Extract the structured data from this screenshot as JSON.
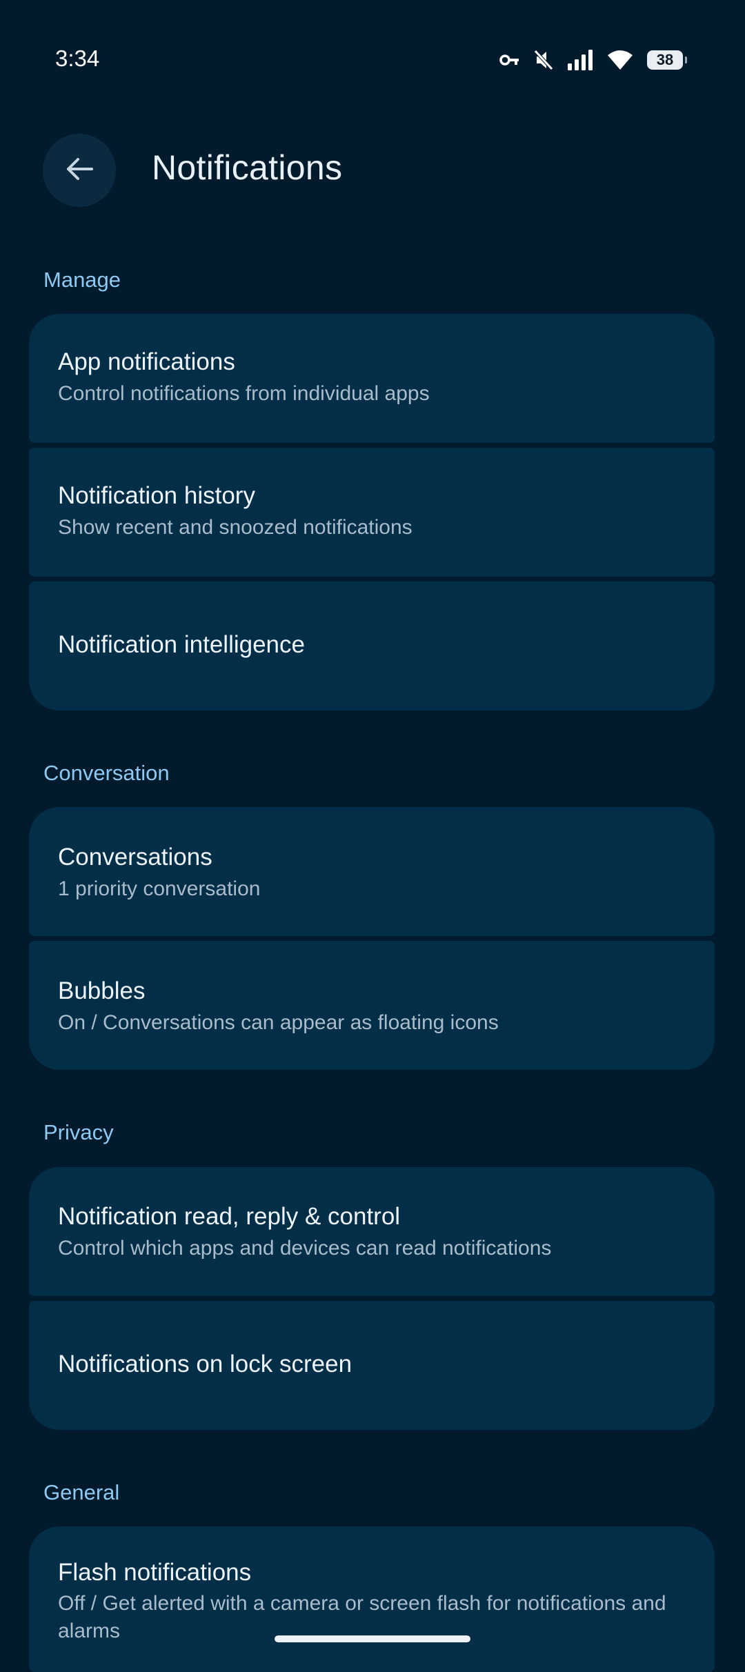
{
  "status_bar": {
    "time": "3:34",
    "battery": "38",
    "icons": [
      "vpn-key-icon",
      "mute-icon",
      "signal-icon",
      "wifi-icon",
      "battery-icon"
    ]
  },
  "header": {
    "title": "Notifications",
    "back_icon": "arrow-left-icon"
  },
  "sections": {
    "manage": {
      "label": "Manage",
      "items": [
        {
          "title": "App notifications",
          "subtitle": "Control notifications from individual apps"
        },
        {
          "title": "Notification history",
          "subtitle": "Show recent and snoozed notifications"
        },
        {
          "title": "Notification intelligence"
        }
      ]
    },
    "conversation": {
      "label": "Conversation",
      "items": [
        {
          "title": "Conversations",
          "subtitle": "1 priority conversation"
        },
        {
          "title": "Bubbles",
          "subtitle": "On / Conversations can appear as floating icons"
        }
      ]
    },
    "privacy": {
      "label": "Privacy",
      "items": [
        {
          "title": "Notification read, reply & control",
          "subtitle": "Control which apps and devices can read notifications"
        },
        {
          "title": "Notifications on lock screen"
        }
      ]
    },
    "general": {
      "label": "General",
      "items": [
        {
          "title": "Flash notifications",
          "subtitle": "Off / Get alerted with a camera or screen flash for notifications and alarms"
        }
      ]
    }
  },
  "colors": {
    "background": "#021b2c",
    "card": "#032e48",
    "accent": "#8fc9f2"
  }
}
